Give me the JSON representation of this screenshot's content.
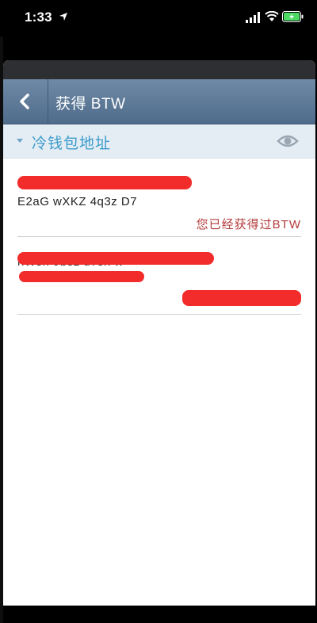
{
  "status_bar": {
    "time": "1:33"
  },
  "nav": {
    "back_icon": "chevron-left-icon",
    "title": "获得 BTW"
  },
  "section": {
    "title": "冷钱包地址",
    "toggle_icon": "eye-icon"
  },
  "wallets": [
    {
      "address": "E2aG wXKZ 4q3z D7",
      "status": "您已经获得过BTW"
    },
    {
      "address": "hWsh 9bsz d7sh w",
      "status": ""
    }
  ],
  "colors": {
    "nav_bar": "#5a7796",
    "section_header_bg": "#e4edf4",
    "section_title": "#3b9bcb",
    "status_text": "#b33a3a",
    "redaction": "#f22b2b"
  }
}
